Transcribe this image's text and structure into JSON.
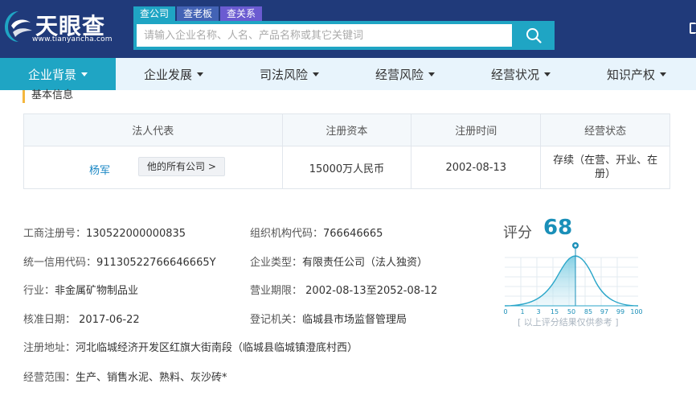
{
  "header": {
    "logo_text": "天眼查",
    "logo_url": "www.tianyancha.com",
    "search_tabs": [
      "查公司",
      "查老板",
      "查关系"
    ],
    "search_placeholder": "请输入企业名称、人名、产品名称或其它关键词"
  },
  "nav": {
    "items": [
      "企业背景",
      "企业发展",
      "司法风险",
      "经营风险",
      "经营状况",
      "知识产权"
    ]
  },
  "section": {
    "title": "基本信息"
  },
  "table": {
    "headers": [
      "法人代表",
      "注册资本",
      "注册时间",
      "经营状态"
    ],
    "legal_rep": "杨军",
    "rep_button": "他的所有公司 >",
    "capital": "15000万人民币",
    "reg_date": "2002-08-13",
    "status": "存续（在营、开业、在册）"
  },
  "details": {
    "reg_no": {
      "label": "工商注册号：",
      "value": "130522000000835"
    },
    "org_code": {
      "label": "组织机构代码：",
      "value": "766646665"
    },
    "credit_code": {
      "label": "统一信用代码：",
      "value": "91130522766646665Y"
    },
    "company_type": {
      "label": "企业类型：",
      "value": "有限责任公司（法人独资）"
    },
    "industry": {
      "label": "行业：",
      "value": "非金属矿物制品业"
    },
    "term": {
      "label": "营业期限：",
      "value": " 2002-08-13至2052-08-12"
    },
    "approval_date": {
      "label": "核准日期：",
      "value": " 2017-06-22"
    },
    "authority": {
      "label": "登记机关：",
      "value": "临城县市场监督管理局"
    },
    "address": {
      "label": "注册地址：",
      "value": "河北临城经济开发区红旗大街南段（临城县临城镇澄底村西）"
    },
    "scope": {
      "label": "经营范围：",
      "value": "生产、销售水泥、熟料、灰沙砖*"
    }
  },
  "score": {
    "label": "评分",
    "value": "68",
    "ticks": [
      "0",
      "1",
      "3",
      "15",
      "50",
      "85",
      "97",
      "99",
      "100"
    ],
    "note": "[ 以上评分结果仅供参考 ]",
    "accent": "#1a8fb8"
  },
  "colors": {
    "header_bg": "#203a7a",
    "accent": "#1fa5c4",
    "nav_bg": "#e8f4fc",
    "link": "#1a87c4",
    "section_marker": "#f4b73e"
  }
}
